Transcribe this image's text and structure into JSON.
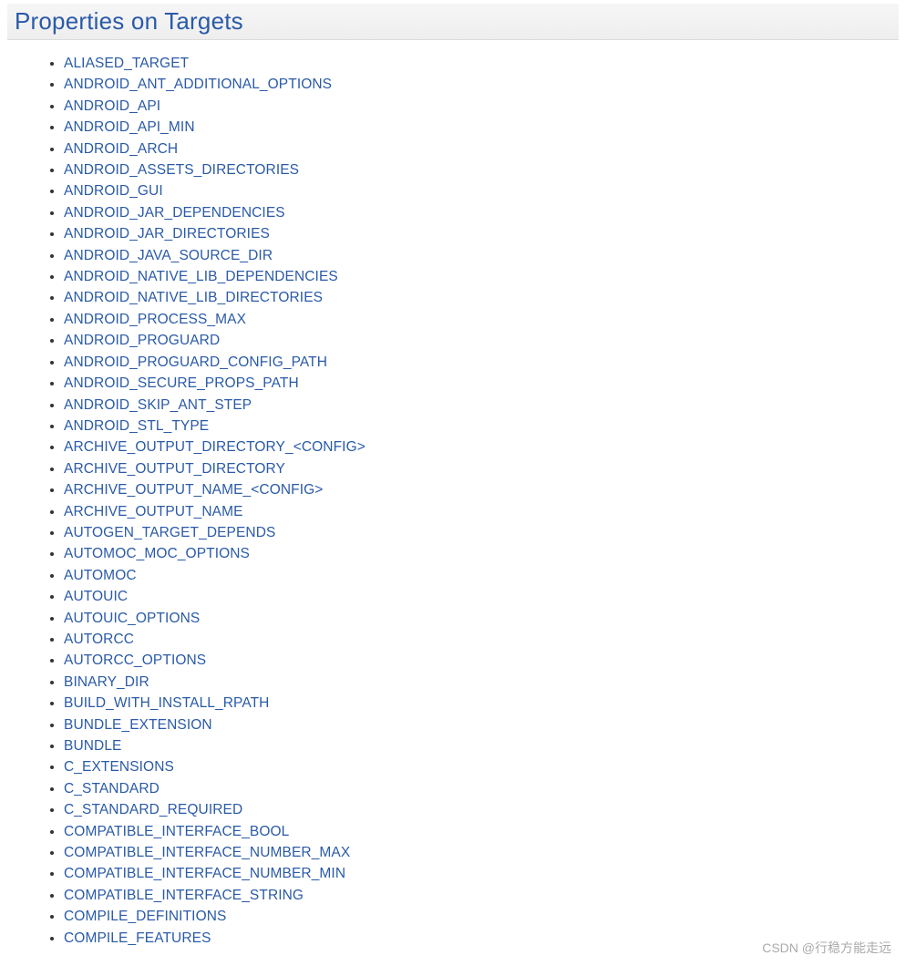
{
  "section": {
    "title": "Properties on Targets",
    "items": [
      "ALIASED_TARGET",
      "ANDROID_ANT_ADDITIONAL_OPTIONS",
      "ANDROID_API",
      "ANDROID_API_MIN",
      "ANDROID_ARCH",
      "ANDROID_ASSETS_DIRECTORIES",
      "ANDROID_GUI",
      "ANDROID_JAR_DEPENDENCIES",
      "ANDROID_JAR_DIRECTORIES",
      "ANDROID_JAVA_SOURCE_DIR",
      "ANDROID_NATIVE_LIB_DEPENDENCIES",
      "ANDROID_NATIVE_LIB_DIRECTORIES",
      "ANDROID_PROCESS_MAX",
      "ANDROID_PROGUARD",
      "ANDROID_PROGUARD_CONFIG_PATH",
      "ANDROID_SECURE_PROPS_PATH",
      "ANDROID_SKIP_ANT_STEP",
      "ANDROID_STL_TYPE",
      "ARCHIVE_OUTPUT_DIRECTORY_<CONFIG>",
      "ARCHIVE_OUTPUT_DIRECTORY",
      "ARCHIVE_OUTPUT_NAME_<CONFIG>",
      "ARCHIVE_OUTPUT_NAME",
      "AUTOGEN_TARGET_DEPENDS",
      "AUTOMOC_MOC_OPTIONS",
      "AUTOMOC",
      "AUTOUIC",
      "AUTOUIC_OPTIONS",
      "AUTORCC",
      "AUTORCC_OPTIONS",
      "BINARY_DIR",
      "BUILD_WITH_INSTALL_RPATH",
      "BUNDLE_EXTENSION",
      "BUNDLE",
      "C_EXTENSIONS",
      "C_STANDARD",
      "C_STANDARD_REQUIRED",
      "COMPATIBLE_INTERFACE_BOOL",
      "COMPATIBLE_INTERFACE_NUMBER_MAX",
      "COMPATIBLE_INTERFACE_NUMBER_MIN",
      "COMPATIBLE_INTERFACE_STRING",
      "COMPILE_DEFINITIONS",
      "COMPILE_FEATURES"
    ]
  },
  "watermark": "CSDN @行稳方能走远"
}
